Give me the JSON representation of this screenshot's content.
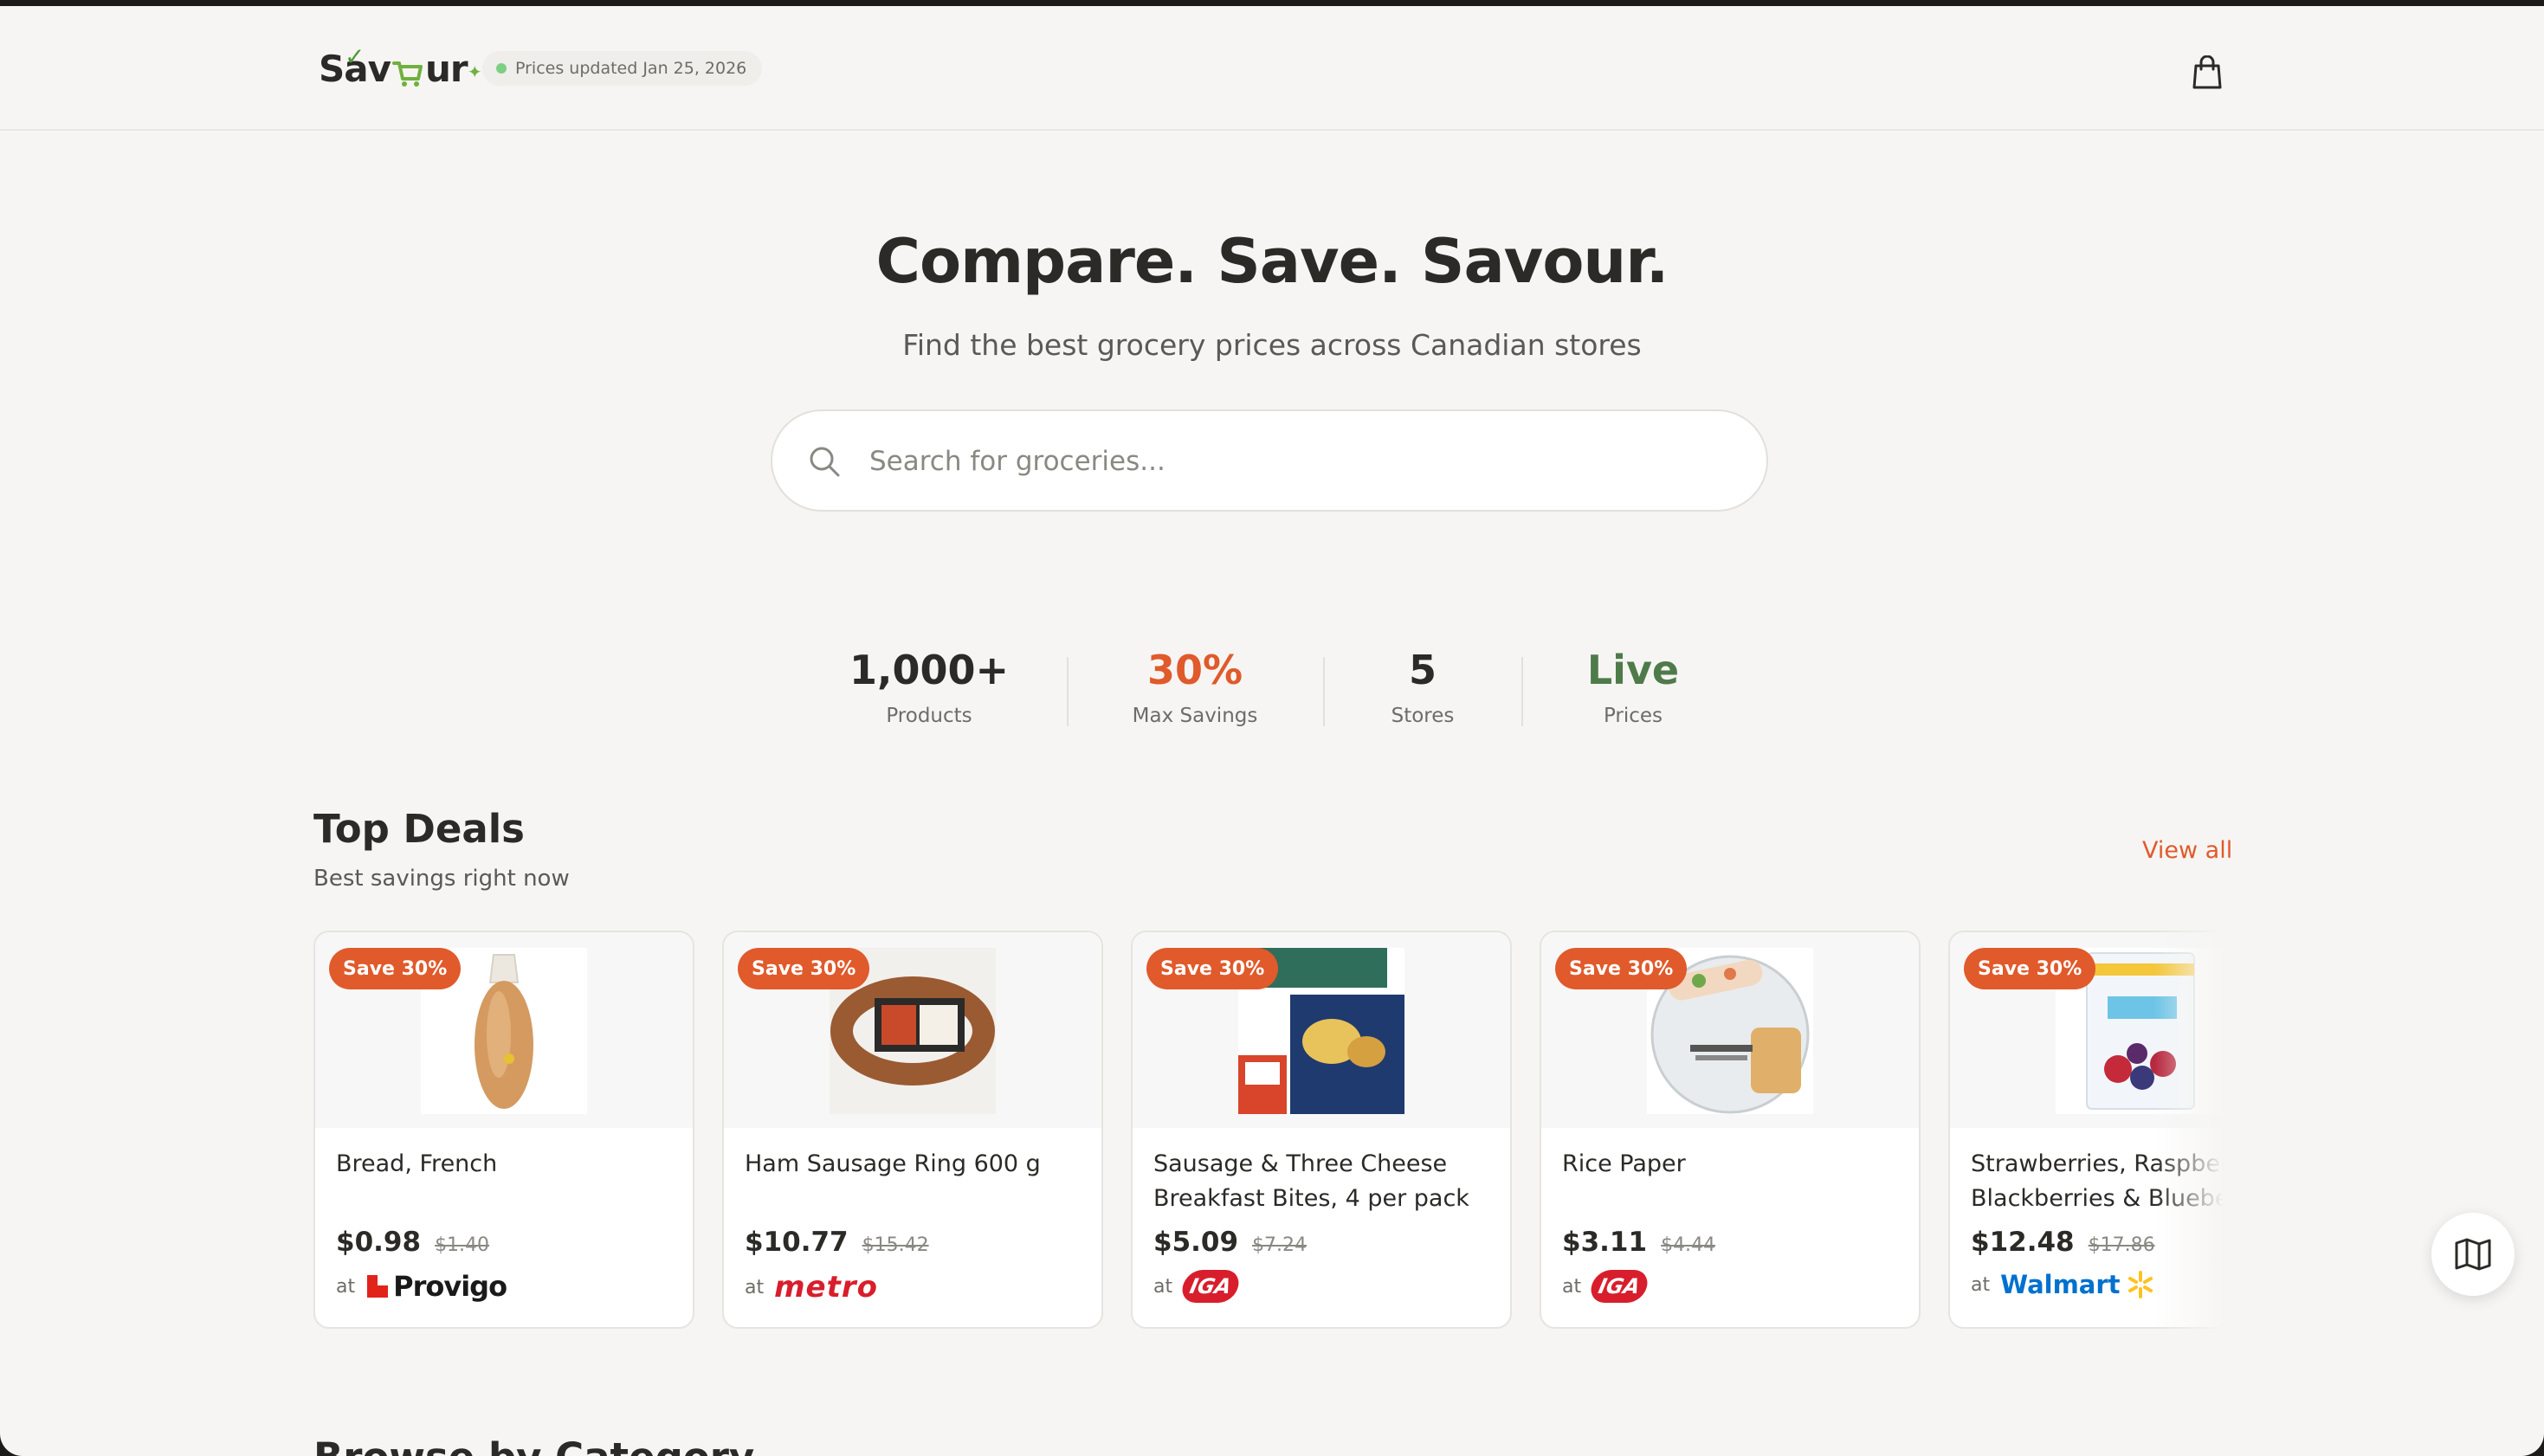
{
  "header": {
    "logo_text_left": "Sav",
    "logo_text_right": "ur",
    "status": "Prices updated Jan 25, 2026",
    "bag_icon": "shopping-bag-icon"
  },
  "hero": {
    "title": "Compare. Save. Savour.",
    "subtitle": "Find the best grocery prices across Canadian stores",
    "search_placeholder": "Search for groceries...",
    "search_value": ""
  },
  "stats": [
    {
      "value": "1,000+",
      "label": "Products",
      "color": "#2b2a27"
    },
    {
      "value": "30%",
      "label": "Max Savings",
      "color": "#e05a2b"
    },
    {
      "value": "5",
      "label": "Stores",
      "color": "#2b2a27"
    },
    {
      "value": "Live",
      "label": "Prices",
      "color": "#4f7a4a"
    }
  ],
  "deals": {
    "title": "Top Deals",
    "subtitle": "Best savings right now",
    "view_all": "View all",
    "items": [
      {
        "badge": "Save 30%",
        "name": "Bread, French",
        "price": "$0.98",
        "was": "$1.40",
        "at": "at",
        "store": "Provigo"
      },
      {
        "badge": "Save 30%",
        "name": "Ham Sausage Ring 600 g",
        "price": "$10.77",
        "was": "$15.42",
        "at": "at",
        "store": "metro"
      },
      {
        "badge": "Save 30%",
        "name": "Sausage & Three Cheese Breakfast Bites, 4 per pack",
        "price": "$5.09",
        "was": "$7.24",
        "at": "at",
        "store": "IGA"
      },
      {
        "badge": "Save 30%",
        "name": "Rice Paper",
        "price": "$3.11",
        "was": "$4.44",
        "at": "at",
        "store": "IGA"
      },
      {
        "badge": "Save 30%",
        "name": "Strawberries, Raspberries, Blackberries & Blueberries",
        "price": "$12.48",
        "was": "$17.86",
        "at": "at",
        "store": "Walmart"
      }
    ]
  },
  "browse_title": "Browse by Category",
  "colors": {
    "accent": "#e05a2b",
    "green": "#4f7a4a",
    "status_dot": "#7dcf86"
  }
}
